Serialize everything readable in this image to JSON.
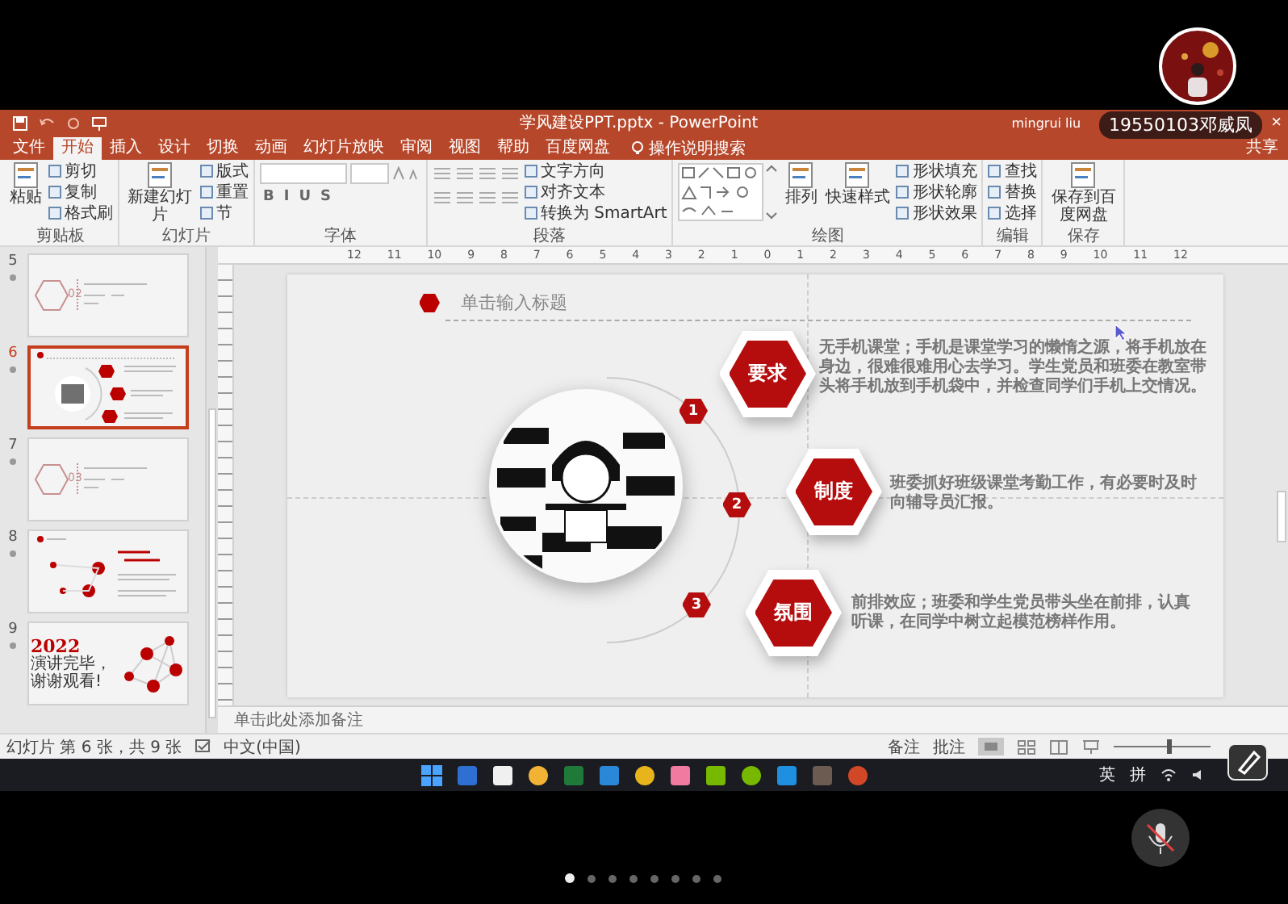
{
  "call": {
    "participant": "19550103邓威凤",
    "close": "×"
  },
  "window": {
    "title": "学风建设PPT.pptx - PowerPoint",
    "user": "mingrui liu",
    "share": "共享",
    "tell_me": "操作说明搜索"
  },
  "tabs": [
    {
      "label": "文件",
      "selected": false
    },
    {
      "label": "开始",
      "selected": true
    },
    {
      "label": "插入",
      "selected": false
    },
    {
      "label": "设计",
      "selected": false
    },
    {
      "label": "切换",
      "selected": false
    },
    {
      "label": "动画",
      "selected": false
    },
    {
      "label": "幻灯片放映",
      "selected": false
    },
    {
      "label": "审阅",
      "selected": false
    },
    {
      "label": "视图",
      "selected": false
    },
    {
      "label": "帮助",
      "selected": false
    },
    {
      "label": "百度网盘",
      "selected": false
    }
  ],
  "ribbon": [
    {
      "label": "剪贴板",
      "items": [
        {
          "kind": "large",
          "label": "粘贴"
        },
        {
          "kind": "small",
          "label": "剪切"
        },
        {
          "kind": "small",
          "label": "复制"
        },
        {
          "kind": "small",
          "label": "格式刷"
        }
      ]
    },
    {
      "label": "幻灯片",
      "items": [
        {
          "kind": "large",
          "label": "新建幻灯片"
        },
        {
          "kind": "small",
          "label": "版式"
        },
        {
          "kind": "small",
          "label": "重置"
        },
        {
          "kind": "small",
          "label": "节"
        }
      ]
    },
    {
      "label": "字体",
      "items": [
        {
          "kind": "fields"
        },
        {
          "kind": "glyphs",
          "labels": [
            "B",
            "I",
            "U",
            "S"
          ]
        }
      ]
    },
    {
      "label": "段落",
      "items": [
        {
          "kind": "icons"
        },
        {
          "kind": "icons"
        },
        {
          "kind": "small",
          "label": "文字方向"
        },
        {
          "kind": "small",
          "label": "对齐文本"
        },
        {
          "kind": "small",
          "label": "转换为 SmartArt"
        }
      ]
    },
    {
      "label": "绘图",
      "items": [
        {
          "kind": "gallery"
        },
        {
          "kind": "large",
          "label": "排列"
        },
        {
          "kind": "large",
          "label": "快速样式"
        },
        {
          "kind": "small",
          "label": "形状填充"
        },
        {
          "kind": "small",
          "label": "形状轮廓"
        },
        {
          "kind": "small",
          "label": "形状效果"
        }
      ]
    },
    {
      "label": "编辑",
      "items": [
        {
          "kind": "small",
          "label": "查找"
        },
        {
          "kind": "small",
          "label": "替换"
        },
        {
          "kind": "small",
          "label": "选择"
        }
      ]
    },
    {
      "label": "保存",
      "items": [
        {
          "kind": "large",
          "label": "保存到百度网盘"
        }
      ]
    }
  ],
  "ruler": [
    "12",
    "11",
    "10",
    "9",
    "8",
    "7",
    "6",
    "5",
    "4",
    "3",
    "2",
    "1",
    "0",
    "1",
    "2",
    "3",
    "4",
    "5",
    "6",
    "7",
    "8",
    "9",
    "10",
    "11",
    "12"
  ],
  "thumbnails": [
    {
      "number": "5",
      "selected": false,
      "kind": "section",
      "section": "02"
    },
    {
      "number": "6",
      "selected": true,
      "kind": "content"
    },
    {
      "number": "7",
      "selected": false,
      "kind": "section",
      "section": "03"
    },
    {
      "number": "8",
      "selected": false,
      "kind": "network"
    },
    {
      "number": "9",
      "selected": false,
      "kind": "closing",
      "title": "2022",
      "subtitle": "演讲完毕，谢谢观看!"
    }
  ],
  "slide": {
    "title": "单击输入标题",
    "points": [
      {
        "number": "1",
        "label": "要求",
        "text": "无手机课堂；手机是课堂学习的懒惰之源，将手机放在身边，很难很难用心去学习。学生党员和班委在教室带头将手机放到手机袋中，并检查同学们手机上交情况。"
      },
      {
        "number": "2",
        "label": "制度",
        "text": "班委抓好班级课堂考勤工作，有必要时及时向辅导员汇报。"
      },
      {
        "number": "3",
        "label": "氛围",
        "text": "前排效应；班委和学生党员带头坐在前排，认真听课，在同学中树立起模范榜样作用。"
      }
    ]
  },
  "notes": {
    "text": "单击此处添加备注"
  },
  "status_bar": {
    "slide_info": "幻灯片 第 6 张，共 9 张",
    "language": "中文(中国)",
    "notes": "备注",
    "comments": "批注",
    "zoom": {
      "level": 0.55
    }
  },
  "taskbar": {
    "tray": [
      "英",
      "拼"
    ]
  },
  "pager": [
    {
      "selected": true
    },
    {
      "selected": false
    },
    {
      "selected": false
    },
    {
      "selected": false
    },
    {
      "selected": false
    },
    {
      "selected": false
    },
    {
      "selected": false
    },
    {
      "selected": false
    }
  ]
}
